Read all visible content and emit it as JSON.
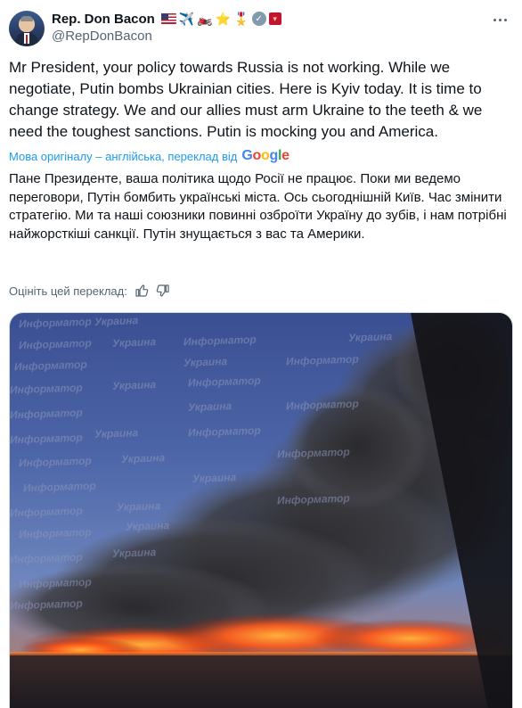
{
  "author": {
    "display_name": "Rep. Don Bacon",
    "handle": "@RepDonBacon",
    "name_emojis": [
      "us-flag",
      "airplane",
      "motorcycle",
      "star",
      "medal",
      "verified-badge",
      "affiliate-badge"
    ]
  },
  "tweet": {
    "text": "Mr President, your policy towards Russia is not working. While we negotiate, Putin bombs Ukrainian cities. Here is Kyiv today. It is time to change strategy. We and our allies must arm Ukraine to the teeth & we need the toughest sanctions. Putin is mocking you and America.",
    "translation_notice": "Мова оригіналу – англійська, переклад від",
    "translation_provider": "Google",
    "translated_text": "Пане Президенте, ваша політика щодо Росії не працює. Поки ми ведемо переговори, Путін бомбить українські міста. Ось сьогоднішній Київ. Час змінити стратегію. Ми та наші союзники повинні озброїти Україну до зубів, і нам потрібні найжорсткіші санкції. Путін знущається з вас та Америки.",
    "rate_translation_label": "Оцініть цей переклад:"
  },
  "media": {
    "watermark_brand": "Информатор",
    "watermark_country": "Украина",
    "alt_subject": "Fire and smoke over Kyiv"
  },
  "colors": {
    "accent": "#1d9bf0",
    "secondary_text": "#536471",
    "primary_text": "#0f1419"
  }
}
